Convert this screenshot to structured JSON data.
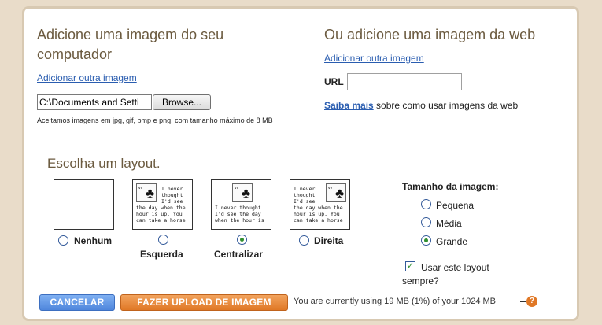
{
  "computer": {
    "title": "Adicione uma imagem do seu computador",
    "add_another": "Adicionar outra imagem",
    "file_value": "C:\\Documents and Setti",
    "browse_label": "Browse...",
    "note": "Aceitamos imagens em jpg, gif, bmp e png, com tamanho máximo de 8 MB"
  },
  "web": {
    "title": "Ou adicione uma imagem da web",
    "add_another": "Adicionar outra imagem",
    "url_label": "URL",
    "url_value": "",
    "learn_more": "Saiba mais",
    "learn_more_rest": "sobre como usar imagens da web"
  },
  "layout": {
    "title": "Escolha um layout.",
    "sample_text": "I never thought I'd see the day when the hour is up. You can take a horse",
    "options": [
      {
        "label": "Nenhum",
        "selected": false
      },
      {
        "label": "Esquerda",
        "selected": false
      },
      {
        "label": "Centralizar",
        "selected": true
      },
      {
        "label": "Direita",
        "selected": false
      }
    ]
  },
  "size": {
    "title": "Tamanho da imagem:",
    "options": [
      {
        "label": "Pequena",
        "selected": false
      },
      {
        "label": "Média",
        "selected": false
      },
      {
        "label": "Grande",
        "selected": true
      }
    ]
  },
  "always": {
    "label_line1": "Usar este layout",
    "label_line2": "sempre?",
    "checked": true
  },
  "footer": {
    "cancel": "CANCELAR",
    "upload": "FAZER UPLOAD DE IMAGEM",
    "quota": "You are currently using 19 MB (1%) of your 1024 MB",
    "help_icon": "?"
  },
  "colors": {
    "title_brown": "#6b5a3f",
    "link_blue": "#2a5db0",
    "cancel_blue": "#4f86dc",
    "upload_orange": "#e07826"
  }
}
